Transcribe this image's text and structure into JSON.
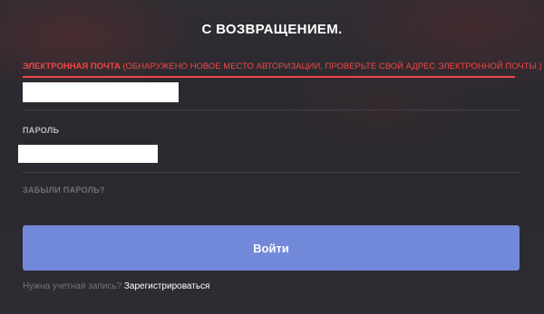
{
  "login": {
    "title": "С ВОЗВРАЩЕНИЕМ.",
    "email": {
      "label": "ЭЛЕКТРОННАЯ ПОЧТА",
      "error_note": " (ОБНАРУЖЕНО НОВОЕ МЕСТО АВТОРИЗАЦИИ, ПРОВЕРЬТЕ СВОЙ АДРЕС ЭЛЕКТРОННОЙ ПОЧТЫ.)",
      "value": ""
    },
    "password": {
      "label": "ПАРОЛЬ",
      "value": ""
    },
    "forgot_password": "ЗАБЫЛИ ПАРОЛЬ?",
    "submit_label": "Войти",
    "register_prompt": "Нужна учетная запись? ",
    "register_link": "Зарегистрироваться"
  },
  "colors": {
    "accent": "#7289da",
    "error": "#f04747",
    "background": "#2b2a30"
  }
}
